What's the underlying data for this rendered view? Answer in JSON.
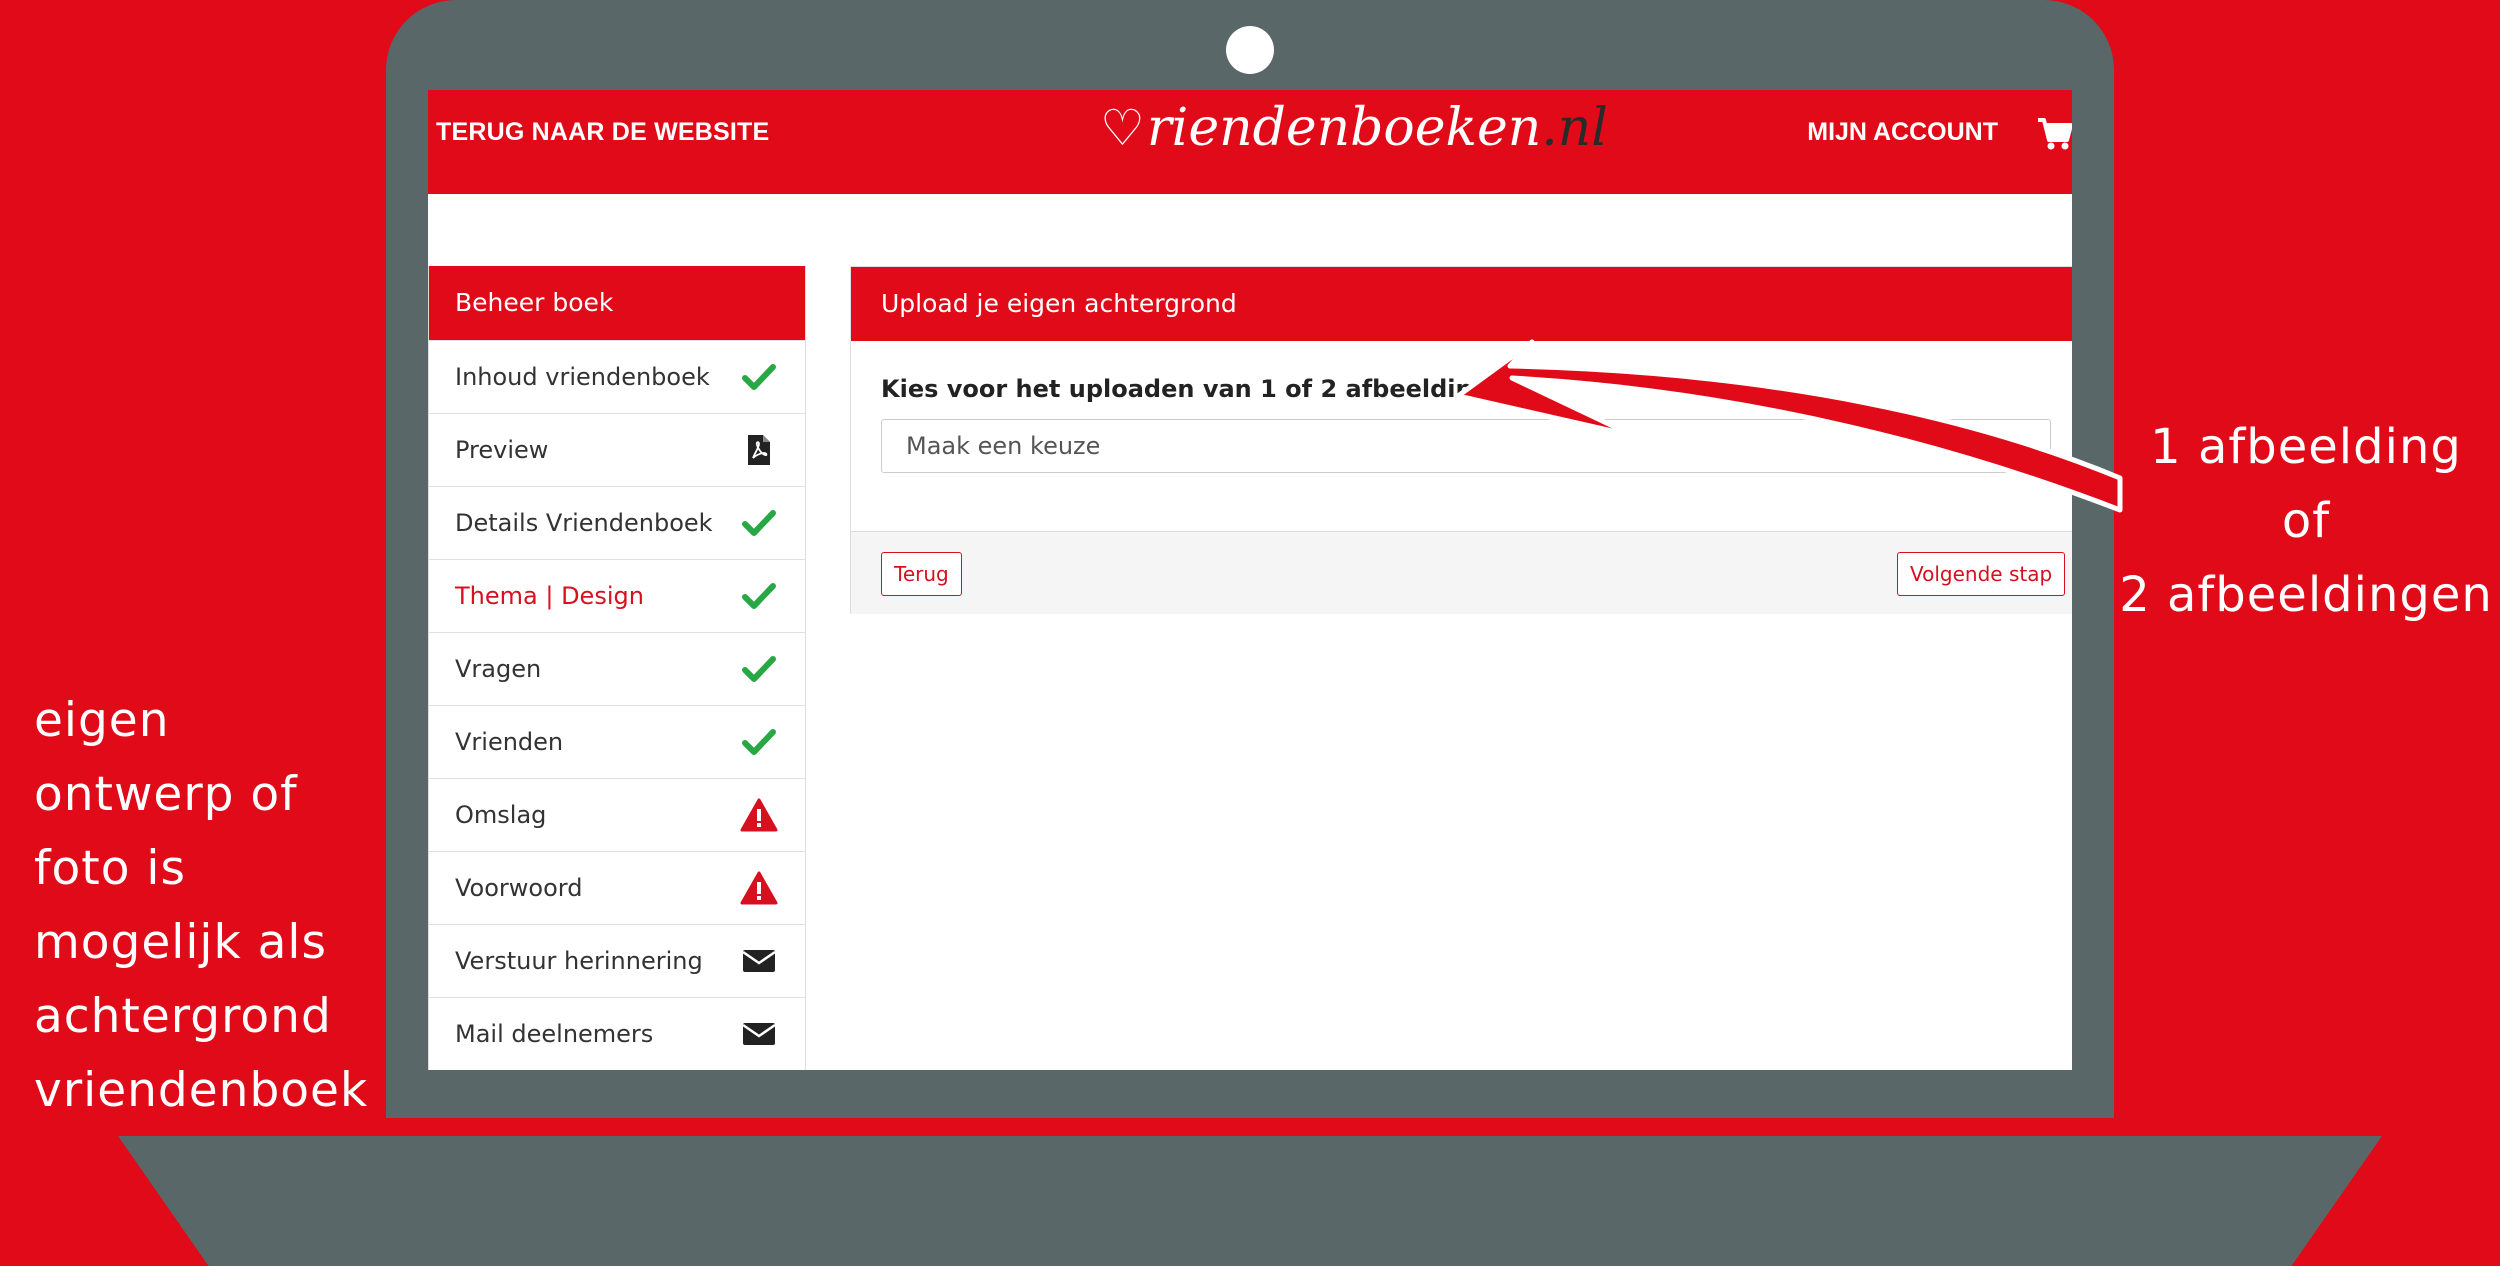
{
  "colors": {
    "brand_red": "#e00a18",
    "laptop_gray": "#5a6768",
    "check_green": "#27a844"
  },
  "header": {
    "back_link": "TERUG NAAR DE WEBSITE",
    "logo_main": "riendenboeken",
    "logo_tld": ".nl",
    "account": "MIJN ACCOUNT",
    "cart_icon": "cart-icon"
  },
  "sidebar": {
    "title": "Beheer boek",
    "items": [
      {
        "label": "Inhoud vriendenboek",
        "icon": "check-icon"
      },
      {
        "label": "Preview",
        "icon": "pdf-icon"
      },
      {
        "label": "Details Vriendenboek",
        "icon": "check-icon"
      },
      {
        "label": "Thema | Design",
        "icon": "check-icon",
        "active": true
      },
      {
        "label": "Vragen",
        "icon": "check-icon"
      },
      {
        "label": "Vrienden",
        "icon": "check-icon"
      },
      {
        "label": "Omslag",
        "icon": "warning-icon"
      },
      {
        "label": "Voorwoord",
        "icon": "warning-icon"
      },
      {
        "label": "Verstuur herinnering",
        "icon": "envelope-icon"
      },
      {
        "label": "Mail deelnemers",
        "icon": "envelope-icon"
      }
    ]
  },
  "panel": {
    "title": "Upload je eigen achtergrond",
    "question": "Kies voor het uploaden van 1 of 2 afbeeldingen",
    "select_value": "Maak een keuze",
    "back_button": "Terug",
    "next_button": "Volgende stap"
  },
  "annotations": {
    "right": [
      "1 afbeelding",
      "of",
      "2 afbeeldingen"
    ],
    "left": [
      "eigen",
      "ontwerp of",
      "foto is",
      "mogelijk als",
      "achtergrond",
      "vriendenboek"
    ]
  }
}
